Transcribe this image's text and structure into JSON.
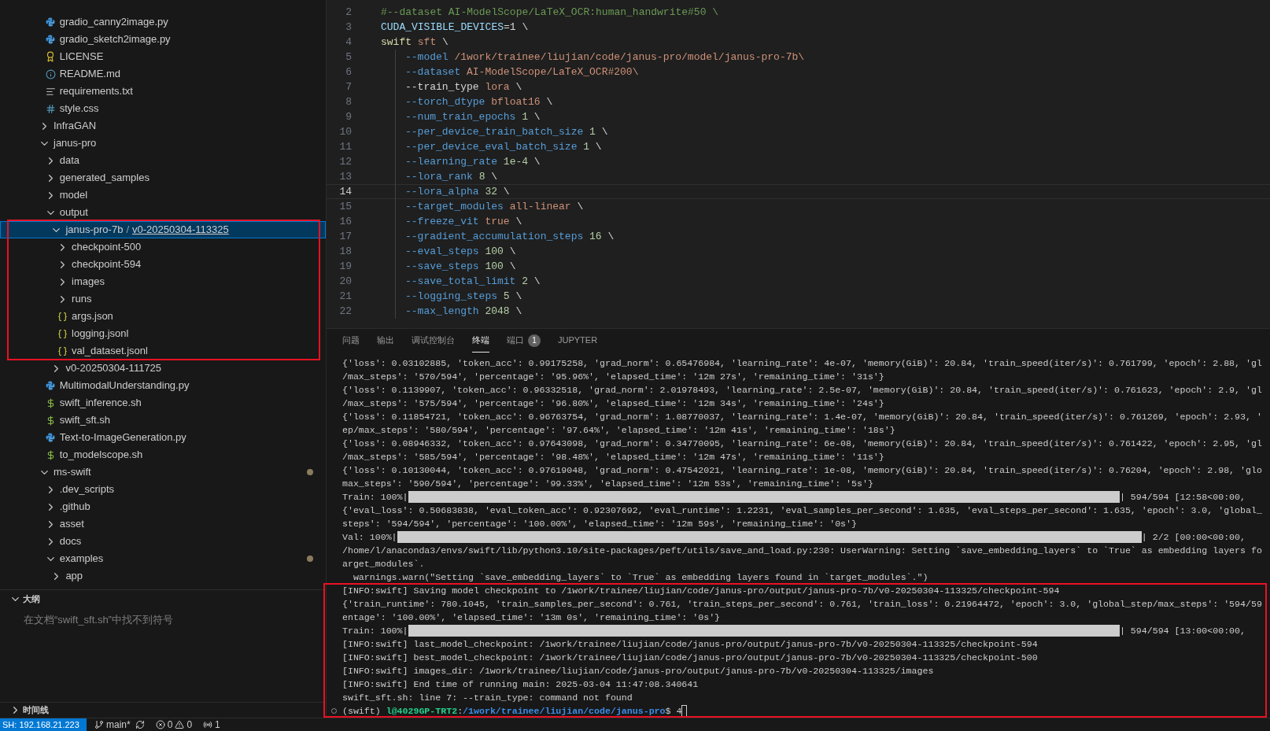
{
  "explorer": {
    "partial_items": [
      {
        "name": "gradio_canny2image.py",
        "kind": "python",
        "selected": false
      },
      {
        "name": "gradio_sketch2image.py",
        "kind": "python",
        "selected": false
      },
      {
        "name": "LICENSE",
        "kind": "license",
        "selected": false
      },
      {
        "name": "README.md",
        "kind": "info",
        "selected": false
      },
      {
        "name": "requirements.txt",
        "kind": "text",
        "selected": false
      },
      {
        "name": "style.css",
        "kind": "css",
        "selected": false
      }
    ],
    "items": [
      {
        "name": "InfraGAN",
        "kind": "folder",
        "expanded": false,
        "selected": false
      },
      {
        "name": "janus-pro",
        "kind": "folder",
        "expanded": true,
        "selected": false,
        "children": [
          {
            "name": "data",
            "kind": "folder",
            "expanded": false,
            "selected": false
          },
          {
            "name": "generated_samples",
            "kind": "folder",
            "expanded": false,
            "selected": false
          },
          {
            "name": "model",
            "kind": "folder",
            "expanded": false,
            "selected": false
          },
          {
            "name": "output",
            "kind": "folder",
            "expanded": true,
            "selected": false,
            "children": [
              {
                "name": "janus-pro-7b",
                "compact_separator": "/",
                "compact_child": "v0-20250304-113325",
                "kind": "folder",
                "expanded": true,
                "selected": true,
                "children": [
                  {
                    "name": "checkpoint-500",
                    "kind": "folder",
                    "expanded": false,
                    "selected": false
                  },
                  {
                    "name": "checkpoint-594",
                    "kind": "folder",
                    "expanded": false,
                    "selected": false
                  },
                  {
                    "name": "images",
                    "kind": "folder",
                    "expanded": false,
                    "selected": false
                  },
                  {
                    "name": "runs",
                    "kind": "folder",
                    "expanded": false,
                    "selected": false
                  },
                  {
                    "name": "args.json",
                    "kind": "json",
                    "selected": false
                  },
                  {
                    "name": "logging.jsonl",
                    "kind": "json",
                    "selected": false
                  },
                  {
                    "name": "val_dataset.jsonl",
                    "kind": "json",
                    "selected": false
                  }
                ]
              },
              {
                "name": "v0-20250304-111725",
                "kind": "folder",
                "expanded": false,
                "selected": false
              }
            ]
          },
          {
            "name": "MultimodalUnderstanding.py",
            "kind": "python",
            "selected": false
          },
          {
            "name": "swift_inference.sh",
            "kind": "shell",
            "selected": false
          },
          {
            "name": "swift_sft.sh",
            "kind": "shell",
            "selected": false
          },
          {
            "name": "Text-to-ImageGeneration.py",
            "kind": "python",
            "selected": false
          },
          {
            "name": "to_modelscope.sh",
            "kind": "shell",
            "selected": false
          }
        ]
      },
      {
        "name": "ms-swift",
        "kind": "folder",
        "expanded": true,
        "selected": false,
        "modified": true,
        "children": [
          {
            "name": ".dev_scripts",
            "kind": "folder",
            "expanded": false,
            "selected": false
          },
          {
            "name": ".github",
            "kind": "folder",
            "expanded": false,
            "selected": false
          },
          {
            "name": "asset",
            "kind": "folder",
            "expanded": false,
            "selected": false
          },
          {
            "name": "docs",
            "kind": "folder",
            "expanded": false,
            "selected": false
          },
          {
            "name": "examples",
            "kind": "folder",
            "expanded": true,
            "selected": false,
            "modified": true,
            "children": [
              {
                "name": "app",
                "kind": "folder",
                "expanded": false,
                "selected": false
              }
            ]
          }
        ]
      }
    ]
  },
  "outline": {
    "title": "大纲",
    "expanded": true,
    "message": "在文档“swift_sft.sh”中找不到符号"
  },
  "timeline": {
    "title": "时间线",
    "expanded": false
  },
  "editor": {
    "lines": [
      {
        "number": "2",
        "current": false,
        "indented": false,
        "tokens": [
          {
            "kind": "comment",
            "text": "#--dataset AI-ModelScope/LaTeX_OCR:human_handwrite#50 \\"
          }
        ]
      },
      {
        "number": "3",
        "current": false,
        "indented": false,
        "tokens": [
          {
            "kind": "var",
            "text": "CUDA_VISIBLE_DEVICES"
          },
          {
            "kind": "plain",
            "text": "=1 \\"
          }
        ]
      },
      {
        "number": "4",
        "current": false,
        "indented": false,
        "tokens": [
          {
            "kind": "func",
            "text": "swift"
          },
          {
            "kind": "string",
            "text": " sft"
          },
          {
            "kind": "plain",
            "text": " \\"
          }
        ]
      },
      {
        "number": "5",
        "current": false,
        "indented": true,
        "tokens": [
          {
            "kind": "flag",
            "text": "--model"
          },
          {
            "kind": "string",
            "text": " /1work/trainee/liujian/code/janus-pro/model/janus-pro-7b\\"
          }
        ]
      },
      {
        "number": "6",
        "current": false,
        "indented": true,
        "tokens": [
          {
            "kind": "flag",
            "text": "--dataset"
          },
          {
            "kind": "string",
            "text": " AI-ModelScope/LaTeX_OCR#200\\"
          }
        ]
      },
      {
        "number": "7",
        "current": false,
        "indented": true,
        "tokens": [
          {
            "kind": "plain",
            "text": "--train_type"
          },
          {
            "kind": "string",
            "text": " lora"
          },
          {
            "kind": "plain",
            "text": " \\"
          }
        ]
      },
      {
        "number": "8",
        "current": false,
        "indented": true,
        "tokens": [
          {
            "kind": "flag",
            "text": "--torch_dtype"
          },
          {
            "kind": "string",
            "text": " bfloat16"
          },
          {
            "kind": "plain",
            "text": " \\"
          }
        ]
      },
      {
        "number": "9",
        "current": false,
        "indented": true,
        "tokens": [
          {
            "kind": "flag",
            "text": "--num_train_epochs"
          },
          {
            "kind": "number",
            "text": " 1"
          },
          {
            "kind": "plain",
            "text": " \\"
          }
        ]
      },
      {
        "number": "10",
        "current": false,
        "indented": true,
        "tokens": [
          {
            "kind": "flag",
            "text": "--per_device_train_batch_size"
          },
          {
            "kind": "number",
            "text": " 1"
          },
          {
            "kind": "plain",
            "text": " \\"
          }
        ]
      },
      {
        "number": "11",
        "current": false,
        "indented": true,
        "tokens": [
          {
            "kind": "flag",
            "text": "--per_device_eval_batch_size"
          },
          {
            "kind": "number",
            "text": " 1"
          },
          {
            "kind": "plain",
            "text": " \\"
          }
        ]
      },
      {
        "number": "12",
        "current": false,
        "indented": true,
        "tokens": [
          {
            "kind": "flag",
            "text": "--learning_rate"
          },
          {
            "kind": "number",
            "text": " 1e-4"
          },
          {
            "kind": "plain",
            "text": " \\"
          }
        ]
      },
      {
        "number": "13",
        "current": false,
        "indented": true,
        "tokens": [
          {
            "kind": "flag",
            "text": "--lora_rank"
          },
          {
            "kind": "number",
            "text": " 8"
          },
          {
            "kind": "plain",
            "text": " \\"
          }
        ]
      },
      {
        "number": "14",
        "current": true,
        "indented": true,
        "tokens": [
          {
            "kind": "flag",
            "text": "--lora_alpha"
          },
          {
            "kind": "number",
            "text": " 32"
          },
          {
            "kind": "plain",
            "text": " \\"
          }
        ]
      },
      {
        "number": "15",
        "current": false,
        "indented": true,
        "tokens": [
          {
            "kind": "flag",
            "text": "--target_modules"
          },
          {
            "kind": "string",
            "text": " all-linear"
          },
          {
            "kind": "plain",
            "text": " \\"
          }
        ]
      },
      {
        "number": "16",
        "current": false,
        "indented": true,
        "tokens": [
          {
            "kind": "flag",
            "text": "--freeze_vit"
          },
          {
            "kind": "string",
            "text": " true"
          },
          {
            "kind": "plain",
            "text": " \\"
          }
        ]
      },
      {
        "number": "17",
        "current": false,
        "indented": true,
        "tokens": [
          {
            "kind": "flag",
            "text": "--gradient_accumulation_steps"
          },
          {
            "kind": "number",
            "text": " 16"
          },
          {
            "kind": "plain",
            "text": " \\"
          }
        ]
      },
      {
        "number": "18",
        "current": false,
        "indented": true,
        "tokens": [
          {
            "kind": "flag",
            "text": "--eval_steps"
          },
          {
            "kind": "number",
            "text": " 100"
          },
          {
            "kind": "plain",
            "text": " \\"
          }
        ]
      },
      {
        "number": "19",
        "current": false,
        "indented": true,
        "tokens": [
          {
            "kind": "flag",
            "text": "--save_steps"
          },
          {
            "kind": "number",
            "text": " 100"
          },
          {
            "kind": "plain",
            "text": " \\"
          }
        ]
      },
      {
        "number": "20",
        "current": false,
        "indented": true,
        "tokens": [
          {
            "kind": "flag",
            "text": "--save_total_limit"
          },
          {
            "kind": "number",
            "text": " 2"
          },
          {
            "kind": "plain",
            "text": " \\"
          }
        ]
      },
      {
        "number": "21",
        "current": false,
        "indented": true,
        "tokens": [
          {
            "kind": "flag",
            "text": "--logging_steps"
          },
          {
            "kind": "number",
            "text": " 5"
          },
          {
            "kind": "plain",
            "text": " \\"
          }
        ]
      },
      {
        "number": "22",
        "current": false,
        "indented": true,
        "tokens": [
          {
            "kind": "flag",
            "text": "--max_length"
          },
          {
            "kind": "number",
            "text": " 2048"
          },
          {
            "kind": "plain",
            "text": " \\"
          }
        ]
      }
    ]
  },
  "panel": {
    "tabs": [
      {
        "label": "问题",
        "selected": false
      },
      {
        "label": "输出",
        "selected": false
      },
      {
        "label": "调试控制台",
        "selected": false
      },
      {
        "label": "终端",
        "selected": true
      },
      {
        "label": "端口",
        "selected": false,
        "badge": "1"
      },
      {
        "label": "JUPYTER",
        "selected": false
      }
    ]
  },
  "terminal": {
    "lines": [
      {
        "kind": "text",
        "text": "{'loss': 0.03102885, 'token_acc': 0.99175258, 'grad_norm': 0.65476984, 'learning_rate': 4e-07, 'memory(GiB)': 20.84, 'train_speed(iter/s)': 0.761799, 'epoch': 2.88, 'gl"
      },
      {
        "kind": "text",
        "text": "/max_steps': '570/594', 'percentage': '95.96%', 'elapsed_time': '12m 27s', 'remaining_time': '31s'}"
      },
      {
        "kind": "text",
        "text": "{'loss': 0.1139907, 'token_acc': 0.96332518, 'grad_norm': 2.01978493, 'learning_rate': 2.5e-07, 'memory(GiB)': 20.84, 'train_speed(iter/s)': 0.761623, 'epoch': 2.9, 'gl"
      },
      {
        "kind": "text",
        "text": "/max_steps': '575/594', 'percentage': '96.80%', 'elapsed_time': '12m 34s', 'remaining_time': '24s'}"
      },
      {
        "kind": "text",
        "text": "{'loss': 0.11854721, 'token_acc': 0.96763754, 'grad_norm': 1.08770037, 'learning_rate': 1.4e-07, 'memory(GiB)': 20.84, 'train_speed(iter/s)': 0.761269, 'epoch': 2.93, '"
      },
      {
        "kind": "text",
        "text": "ep/max_steps': '580/594', 'percentage': '97.64%', 'elapsed_time': '12m 41s', 'remaining_time': '18s'}"
      },
      {
        "kind": "text",
        "text": "{'loss': 0.08946332, 'token_acc': 0.97643098, 'grad_norm': 0.34770095, 'learning_rate': 6e-08, 'memory(GiB)': 20.84, 'train_speed(iter/s)': 0.761422, 'epoch': 2.95, 'gl"
      },
      {
        "kind": "text",
        "text": "/max_steps': '585/594', 'percentage': '98.48%', 'elapsed_time': '12m 47s', 'remaining_time': '11s'}"
      },
      {
        "kind": "text",
        "text": "{'loss': 0.10130044, 'token_acc': 0.97619048, 'grad_norm': 0.47542021, 'learning_rate': 1e-08, 'memory(GiB)': 20.84, 'train_speed(iter/s)': 0.76204, 'epoch': 2.98, 'glo"
      },
      {
        "kind": "text",
        "text": "max_steps': '590/594', 'percentage': '99.33%', 'elapsed_time': '12m 53s', 'remaining_time': '5s'}"
      },
      {
        "kind": "progress",
        "label": "Train: 100%|",
        "level": 1,
        "tail": "| 594/594 [12:58<00:00,"
      },
      {
        "kind": "text",
        "text": "{'eval_loss': 0.50683838, 'eval_token_acc': 0.92307692, 'eval_runtime': 1.2231, 'eval_samples_per_second': 1.635, 'eval_steps_per_second': 1.635, 'epoch': 3.0, 'global_"
      },
      {
        "kind": "text",
        "text": "steps': '594/594', 'percentage': '100.00%', 'elapsed_time': '12m 59s', 'remaining_time': '0s'}"
      },
      {
        "kind": "progress",
        "label": "Val: 100%|",
        "level": 1,
        "tail": "| 2/2 [00:00<00:00,"
      },
      {
        "kind": "text",
        "text": "/home/l/anaconda3/envs/swift/lib/python3.10/site-packages/peft/utils/save_and_load.py:230: UserWarning: Setting `save_embedding_layers` to `True` as embedding layers fo"
      },
      {
        "kind": "text",
        "text": "arget_modules`."
      },
      {
        "kind": "text",
        "text": "  warnings.warn(\"Setting `save_embedding_layers` to `True` as embedding layers found in `target_modules`.\")"
      },
      {
        "kind": "text",
        "text": "[INFO:swift] Saving model checkpoint to /1work/trainee/liujian/code/janus-pro/output/janus-pro-7b/v0-20250304-113325/checkpoint-594"
      },
      {
        "kind": "text",
        "text": "{'train_runtime': 780.1045, 'train_samples_per_second': 0.761, 'train_steps_per_second': 0.761, 'train_loss': 0.21964472, 'epoch': 3.0, 'global_step/max_steps': '594/59"
      },
      {
        "kind": "text",
        "text": "entage': '100.00%', 'elapsed_time': '13m 0s', 'remaining_time': '0s'}"
      },
      {
        "kind": "progress",
        "label": "Train: 100%|",
        "level": 1,
        "tail": "| 594/594 [13:00<00:00,"
      },
      {
        "kind": "text",
        "text": "[INFO:swift] last_model_checkpoint: /1work/trainee/liujian/code/janus-pro/output/janus-pro-7b/v0-20250304-113325/checkpoint-594"
      },
      {
        "kind": "text",
        "text": "[INFO:swift] best_model_checkpoint: /1work/trainee/liujian/code/janus-pro/output/janus-pro-7b/v0-20250304-113325/checkpoint-500"
      },
      {
        "kind": "text",
        "text": "[INFO:swift] images_dir: /1work/trainee/liujian/code/janus-pro/output/janus-pro-7b/v0-20250304-113325/images"
      },
      {
        "kind": "text",
        "text": "[INFO:swift] End time of running main: 2025-03-04 11:47:08.340641"
      },
      {
        "kind": "text",
        "text": "swift_sft.sh: line 7: --train_type: command not found"
      },
      {
        "kind": "prompt",
        "env": "(swift)",
        "user": "l@4029GP-TRT2",
        "separator": ":",
        "path": "/1work/trainee/liujian/code/janus-pro",
        "input": "$ 4"
      }
    ]
  },
  "status_bar": {
    "remote": "SH: 192.168.21.223",
    "branch": "main*",
    "errors": "0",
    "warnings": "0",
    "ports": "1"
  }
}
